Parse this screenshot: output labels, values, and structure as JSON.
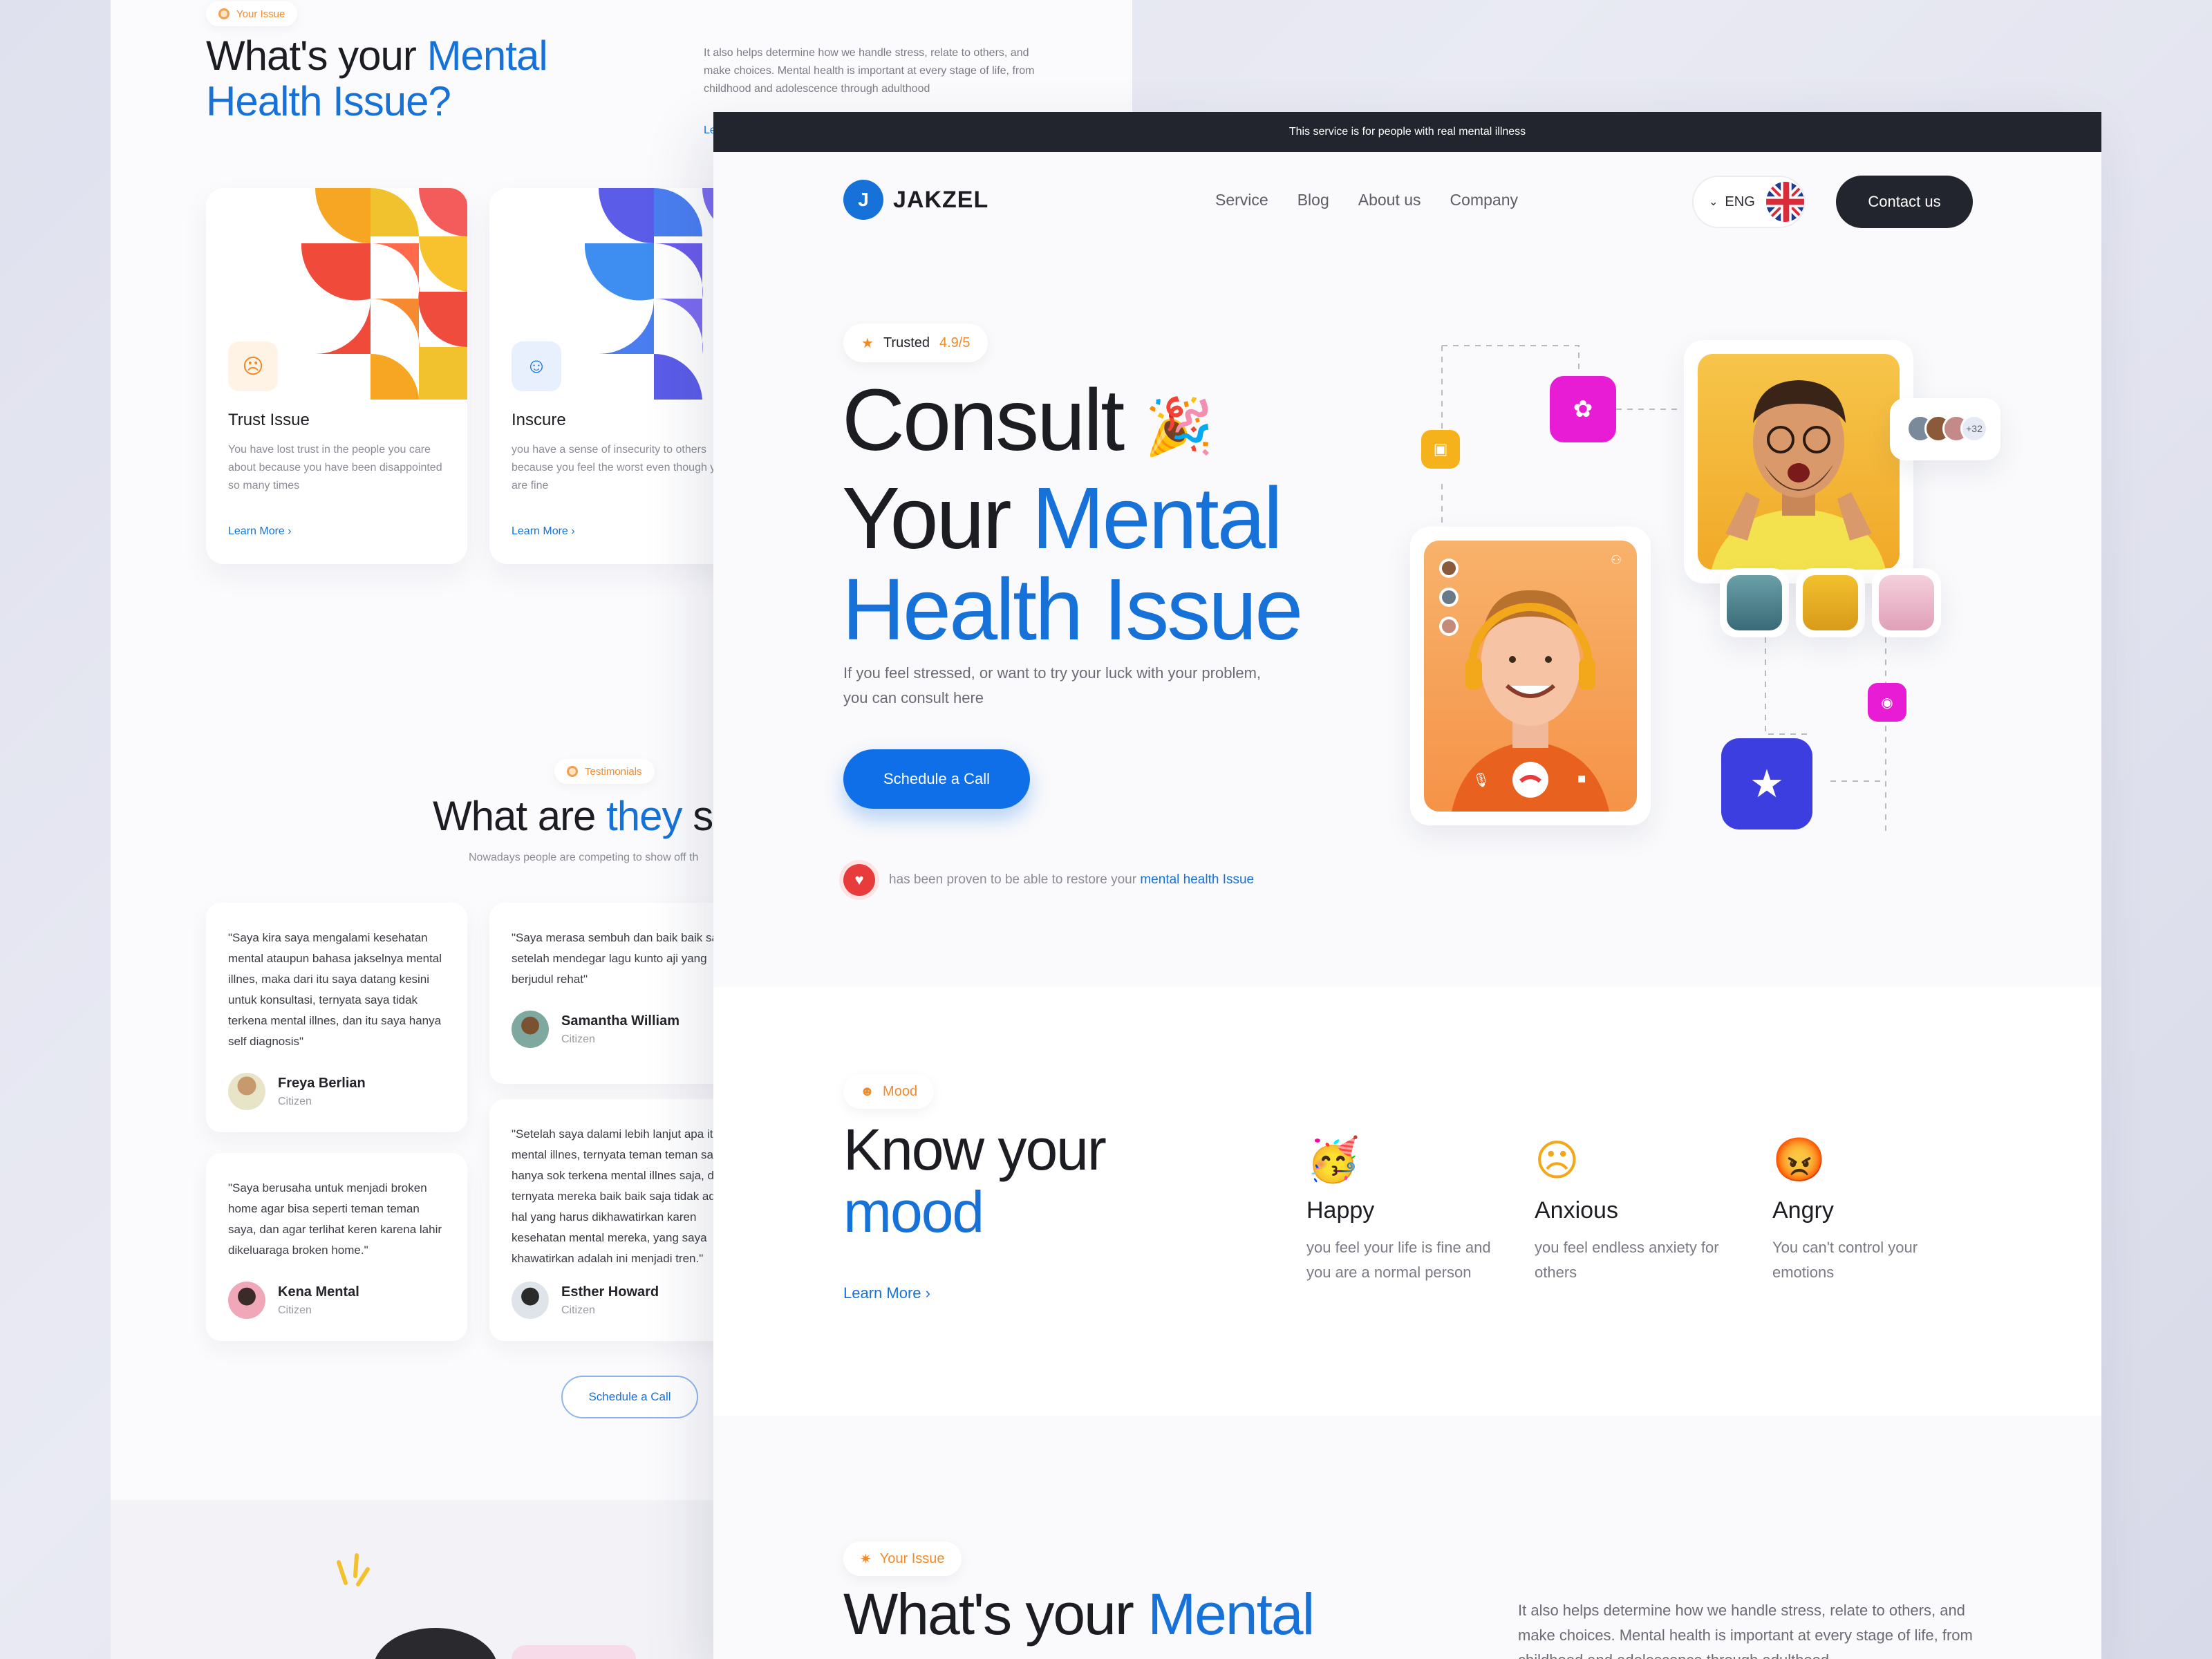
{
  "back": {
    "your_issue_pill": "Your Issue",
    "title_a": "What's your ",
    "title_b": "Mental",
    "title_c": "Health Issue?",
    "desc": "It also helps determine how we handle stress, relate to others, and make choices. Mental health is important at every stage of life, from childhood and adolescence through adulthood",
    "learn_top": "Le",
    "cards": [
      {
        "title": "Trust Issue",
        "desc": "You have lost trust in the people you care about because you have been disappointed so many times",
        "learn": "Learn More",
        "face": "☹"
      },
      {
        "title": "Inscure",
        "desc": "you have a sense of insecurity to others because you feel the worst even though you are fine",
        "learn": "Learn More",
        "face": "☺"
      }
    ],
    "testimonials_pill": "Testimonials",
    "test_title_a": "What are ",
    "test_title_b": "they",
    "test_title_c": " sa",
    "test_sub": "Nowadays people are competing to show off th",
    "testimonials": [
      {
        "quote": "\"Saya kira saya mengalami kesehatan mental ataupun bahasa jakselnya mental illnes, maka dari itu saya datang kesini untuk konsultasi, ternyata saya tidak terkena mental illnes, dan itu saya hanya self diagnosis\"",
        "name": "Freya Berlian",
        "role": "Citizen"
      },
      {
        "quote": "\"Saya berusaha untuk menjadi broken home agar bisa seperti teman teman saya, dan agar terlihat keren karena lahir dikeluaraga broken home.\"",
        "name": "Kena Mental",
        "role": "Citizen"
      },
      {
        "quote": "\"Saya merasa sembuh dan baik baik saj setelah mendegar lagu kunto aji yang berjudul rehat\"",
        "name": "Samantha William",
        "role": "Citizen"
      },
      {
        "quote": "\"Setelah saya dalami lebih lanjut apa itu mental illnes, ternyata teman teman sa hanya sok terkena mental illnes saja, da ternyata mereka baik baik saja tidak ada hal yang harus dikhawatirkan karen kesehatan mental mereka, yang saya khawatirkan adalah ini menjadi tren.\"",
        "name": "Esther Howard",
        "role": "Citizen"
      }
    ],
    "schedule": "Schedule a Call"
  },
  "front": {
    "notice": "This service is for people with real mental illness",
    "logo_mark": "J",
    "logo_text": "JAKZEL",
    "nav": [
      "Service",
      "Blog",
      "About us",
      "Company"
    ],
    "lang": "ENG",
    "contact": "Contact us",
    "trusted_label": "Trusted",
    "trusted_score": "4.9/5",
    "hero_line1": "Consult",
    "hero_line2a": "Your ",
    "hero_line2b": "Mental",
    "hero_line3": "Health Issue",
    "hero_desc": "If you feel stressed, or want to try your luck with your problem, you can consult here",
    "schedule": "Schedule a Call",
    "proof_text": "has been proven to be able to restore your ",
    "proof_link": "mental health Issue",
    "avatar_count": "+32",
    "mood_pill": "Mood",
    "mood_title_a": "Know your",
    "mood_title_b": "mood",
    "mood_learn": "Learn More",
    "moods": [
      {
        "emoji": "🥳",
        "name": "Happy",
        "desc": "you feel your life is fine and you are a normal person"
      },
      {
        "emoji": "☹",
        "name": "Anxious",
        "desc": "you feel endless anxiety for others"
      },
      {
        "emoji": "😡",
        "name": "Angry",
        "desc": "You can't control your emotions"
      }
    ],
    "issue_pill": "Your Issue",
    "issue_title_a": "What's your ",
    "issue_title_b": "Mental",
    "issue_desc": "It also helps determine how we handle stress, relate to others, and make choices. Mental health is important at every stage of life, from childhood and adolescence through adulthood"
  }
}
